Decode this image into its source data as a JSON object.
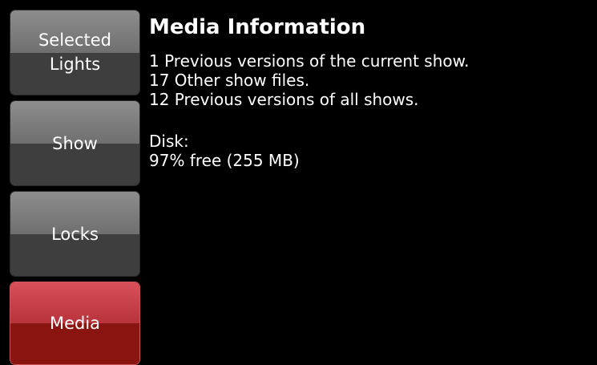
{
  "sidebar": {
    "buttons": [
      {
        "label": "Selected\nLights",
        "active": false
      },
      {
        "label": "Show",
        "active": false
      },
      {
        "label": "Locks",
        "active": false
      },
      {
        "label": "Media",
        "active": true
      }
    ]
  },
  "main": {
    "title": "Media Information",
    "lines": [
      "1 Previous versions of the current show.",
      "17 Other show files.",
      "12 Previous versions of all shows."
    ],
    "disk_label": "Disk:",
    "disk_value": "97% free (255 MB)"
  }
}
